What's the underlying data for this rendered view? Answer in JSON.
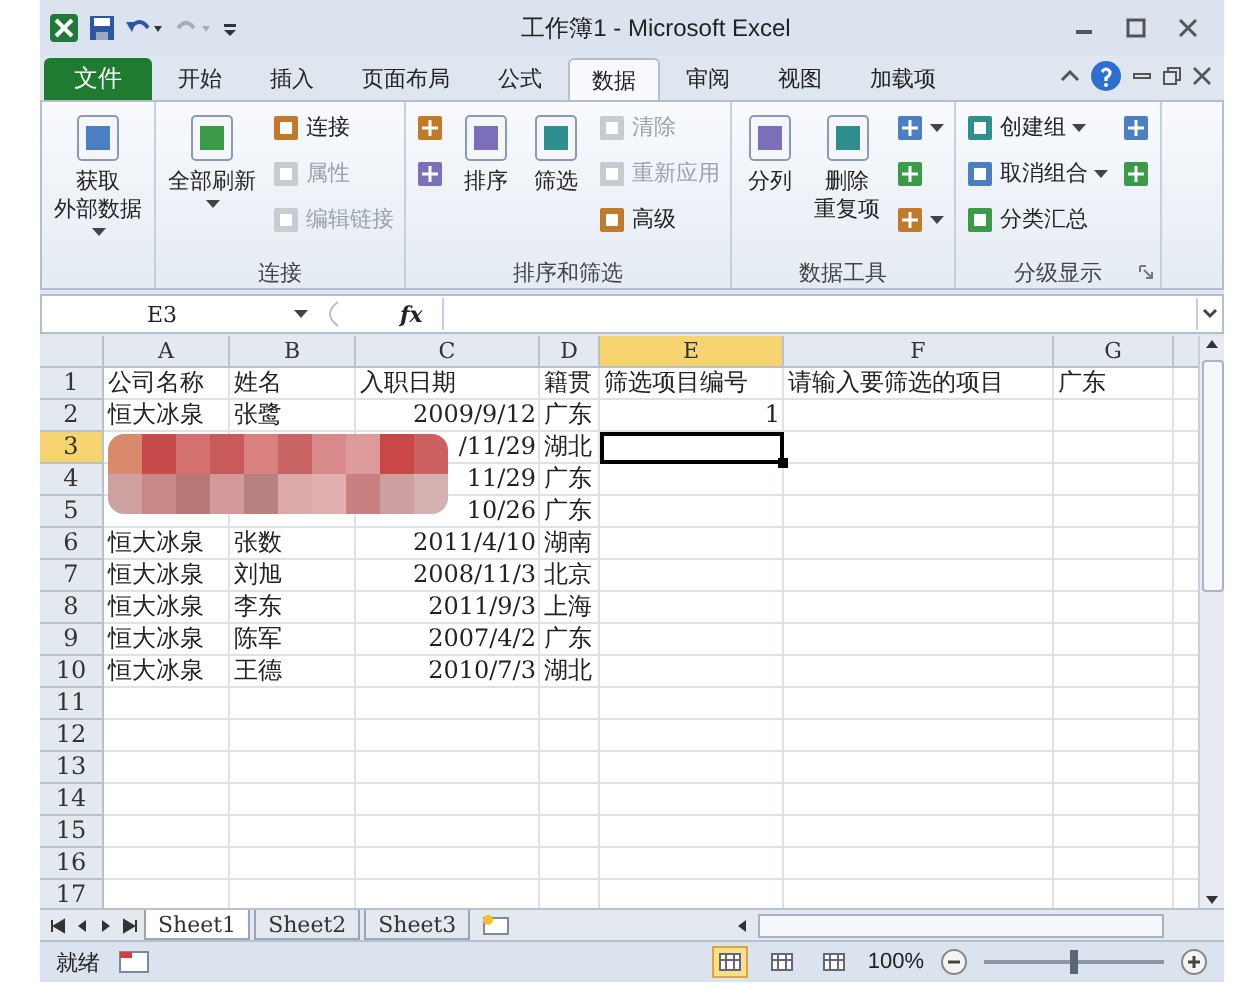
{
  "window": {
    "title": "工作簿1 - Microsoft Excel"
  },
  "tabs": [
    {
      "label": "文件",
      "kind": "file",
      "selected": false
    },
    {
      "label": "开始",
      "kind": "tab",
      "selected": false
    },
    {
      "label": "插入",
      "kind": "tab",
      "selected": false
    },
    {
      "label": "页面布局",
      "kind": "tab",
      "selected": false
    },
    {
      "label": "公式",
      "kind": "tab",
      "selected": false
    },
    {
      "label": "数据",
      "kind": "tab",
      "selected": true
    },
    {
      "label": "审阅",
      "kind": "tab",
      "selected": false
    },
    {
      "label": "视图",
      "kind": "tab",
      "selected": false
    },
    {
      "label": "加载项",
      "kind": "tab",
      "selected": false
    }
  ],
  "ribbon": {
    "groups": [
      {
        "columns": [
          [
            {
              "kind": "large",
              "lines": [
                "获取",
                "外部数据"
              ],
              "dropdown": true,
              "disabled": false
            }
          ]
        ]
      },
      {
        "label": "连接",
        "columns": [
          [
            {
              "kind": "large",
              "lines": [
                "全部刷新"
              ],
              "dropdown": true,
              "disabled": false
            }
          ],
          [
            {
              "kind": "small",
              "label": "连接",
              "dropdown": false,
              "disabled": false
            },
            {
              "kind": "small",
              "label": "属性",
              "dropdown": false,
              "disabled": true
            },
            {
              "kind": "small",
              "label": "编辑链接",
              "dropdown": false,
              "disabled": true
            }
          ]
        ]
      },
      {
        "label": "排序和筛选",
        "columns": [
          [
            {
              "kind": "icon",
              "dropdown": false,
              "disabled": false
            },
            {
              "kind": "icon",
              "dropdown": false,
              "disabled": false
            }
          ],
          [
            {
              "kind": "large",
              "lines": [
                "排序"
              ],
              "dropdown": false,
              "disabled": false
            }
          ],
          [
            {
              "kind": "large",
              "lines": [
                "筛选"
              ],
              "dropdown": false,
              "disabled": false
            }
          ],
          [
            {
              "kind": "small",
              "label": "清除",
              "dropdown": false,
              "disabled": true
            },
            {
              "kind": "small",
              "label": "重新应用",
              "dropdown": false,
              "disabled": true
            },
            {
              "kind": "small",
              "label": "高级",
              "dropdown": false,
              "disabled": false
            }
          ]
        ]
      },
      {
        "label": "数据工具",
        "columns": [
          [
            {
              "kind": "large",
              "lines": [
                "分列"
              ],
              "dropdown": false,
              "disabled": false
            }
          ],
          [
            {
              "kind": "large",
              "lines": [
                "删除",
                "重复项"
              ],
              "dropdown": false,
              "disabled": false
            }
          ],
          [
            {
              "kind": "icon",
              "dropdown": true,
              "disabled": false
            },
            {
              "kind": "icon",
              "dropdown": false,
              "disabled": false
            },
            {
              "kind": "icon",
              "dropdown": true,
              "disabled": false
            }
          ]
        ]
      },
      {
        "label": "分级显示",
        "launcher": true,
        "columns": [
          [
            {
              "kind": "small",
              "label": "创建组",
              "dropdown": true,
              "disabled": false
            },
            {
              "kind": "small",
              "label": "取消组合",
              "dropdown": true,
              "disabled": false
            },
            {
              "kind": "small",
              "label": "分类汇总",
              "dropdown": false,
              "disabled": false
            }
          ],
          [
            {
              "kind": "icon",
              "dropdown": false,
              "disabled": false
            },
            {
              "kind": "icon",
              "dropdown": false,
              "disabled": false
            }
          ]
        ]
      }
    ]
  },
  "formula_bar": {
    "name_box": "E3",
    "fx_label": "fx"
  },
  "columns": [
    {
      "label": "A",
      "selected": false
    },
    {
      "label": "B",
      "selected": false
    },
    {
      "label": "C",
      "selected": false
    },
    {
      "label": "D",
      "selected": false
    },
    {
      "label": "E",
      "selected": true
    },
    {
      "label": "F",
      "selected": false
    },
    {
      "label": "G",
      "selected": false
    }
  ],
  "rows": [
    {
      "header": "1",
      "selected": false,
      "cells": [
        {
          "kind": "text",
          "text": "公司名称"
        },
        {
          "kind": "text",
          "text": "姓名"
        },
        {
          "kind": "text",
          "text": "入职日期"
        },
        {
          "kind": "text",
          "text": "籍贯"
        },
        {
          "kind": "text",
          "text": "筛选项目编号"
        },
        {
          "kind": "text",
          "text": "请输入要筛选的项目"
        },
        {
          "kind": "text",
          "text": "广东"
        }
      ]
    },
    {
      "header": "2",
      "selected": false,
      "cells": [
        {
          "kind": "text",
          "text": "恒大冰泉"
        },
        {
          "kind": "text",
          "text": "张鹭"
        },
        {
          "kind": "number",
          "text": "2009/9/12"
        },
        {
          "kind": "text",
          "text": "广东"
        },
        {
          "kind": "number",
          "text": "1"
        },
        null,
        null
      ]
    },
    {
      "header": "3",
      "selected": true,
      "cells": [
        null,
        null,
        {
          "kind": "number",
          "text": "/11/29"
        },
        {
          "kind": "text",
          "text": "湖北"
        },
        null,
        null,
        null
      ]
    },
    {
      "header": "4",
      "selected": false,
      "cells": [
        null,
        null,
        {
          "kind": "number",
          "text": "11/29"
        },
        {
          "kind": "text",
          "text": "广东"
        },
        null,
        null,
        null
      ]
    },
    {
      "header": "5",
      "selected": false,
      "cells": [
        null,
        null,
        {
          "kind": "number",
          "text": "10/26"
        },
        {
          "kind": "text",
          "text": "广东"
        },
        null,
        null,
        null
      ]
    },
    {
      "header": "6",
      "selected": false,
      "cells": [
        {
          "kind": "text",
          "text": "恒大冰泉"
        },
        {
          "kind": "text",
          "text": "张数"
        },
        {
          "kind": "number",
          "text": "2011/4/10"
        },
        {
          "kind": "text",
          "text": "湖南"
        },
        null,
        null,
        null
      ]
    },
    {
      "header": "7",
      "selected": false,
      "cells": [
        {
          "kind": "text",
          "text": "恒大冰泉"
        },
        {
          "kind": "text",
          "text": "刘旭"
        },
        {
          "kind": "number",
          "text": "2008/11/3"
        },
        {
          "kind": "text",
          "text": "北京"
        },
        null,
        null,
        null
      ]
    },
    {
      "header": "8",
      "selected": false,
      "cells": [
        {
          "kind": "text",
          "text": "恒大冰泉"
        },
        {
          "kind": "text",
          "text": "李东"
        },
        {
          "kind": "number",
          "text": "2011/9/3"
        },
        {
          "kind": "text",
          "text": "上海"
        },
        null,
        null,
        null
      ]
    },
    {
      "header": "9",
      "selected": false,
      "cells": [
        {
          "kind": "text",
          "text": "恒大冰泉"
        },
        {
          "kind": "text",
          "text": "陈军"
        },
        {
          "kind": "number",
          "text": "2007/4/2"
        },
        {
          "kind": "text",
          "text": "广东"
        },
        null,
        null,
        null
      ]
    },
    {
      "header": "10",
      "selected": false,
      "cells": [
        {
          "kind": "text",
          "text": "恒大冰泉"
        },
        {
          "kind": "text",
          "text": "王德"
        },
        {
          "kind": "number",
          "text": "2010/7/3"
        },
        {
          "kind": "text",
          "text": "湖北"
        },
        null,
        null,
        null
      ]
    },
    {
      "header": "11",
      "selected": false
    },
    {
      "header": "12",
      "selected": false
    },
    {
      "header": "13",
      "selected": false
    },
    {
      "header": "14",
      "selected": false
    },
    {
      "header": "15",
      "selected": false
    },
    {
      "header": "16",
      "selected": false
    },
    {
      "header": "17",
      "selected": false
    }
  ],
  "sheets": [
    {
      "label": "Sheet1",
      "selected": true
    },
    {
      "label": "Sheet2",
      "selected": false
    },
    {
      "label": "Sheet3",
      "selected": false
    }
  ],
  "status_bar": {
    "status": "就绪",
    "views": [
      {
        "selected": true
      },
      {
        "selected": false
      },
      {
        "selected": false
      }
    ],
    "zoom": "100%",
    "zoom_slider": {
      "level": 0.5
    }
  }
}
